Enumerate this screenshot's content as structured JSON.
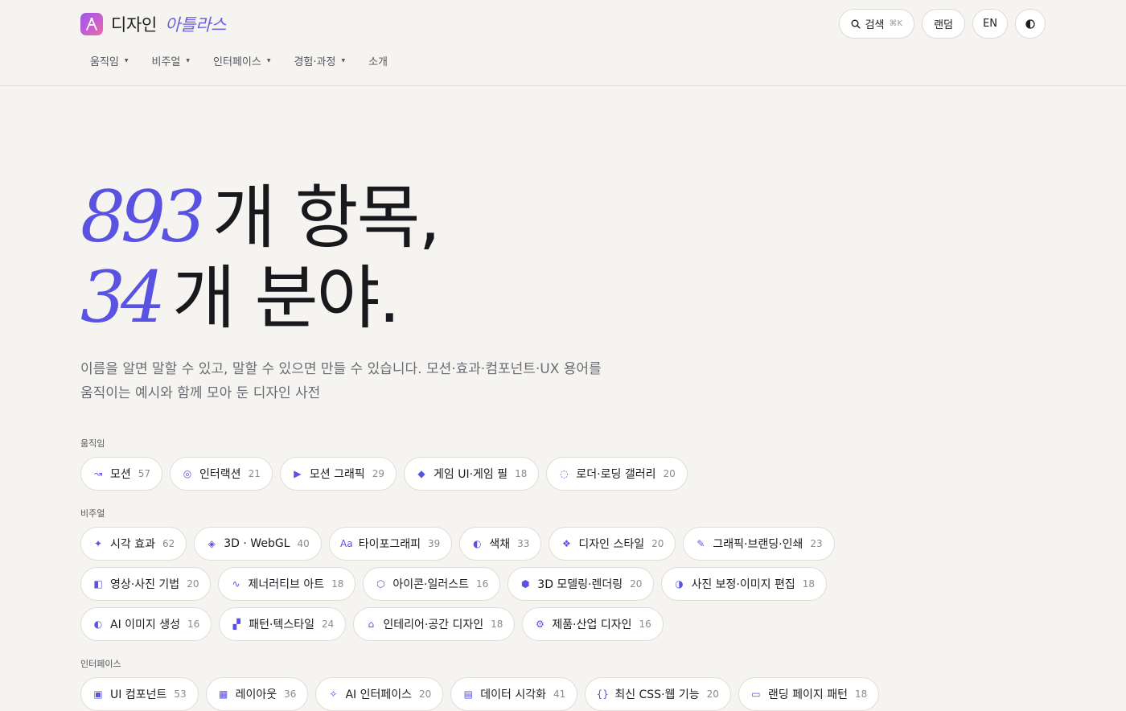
{
  "brand": {
    "name": "디자인",
    "accent": "아틀라스"
  },
  "top_actions": {
    "search_label": "검색",
    "search_shortcut": "⌘K",
    "random_label": "랜덤",
    "lang_label": "EN"
  },
  "nav": {
    "items": [
      {
        "label": "움직임",
        "has_menu": true
      },
      {
        "label": "비주얼",
        "has_menu": true
      },
      {
        "label": "인터페이스",
        "has_menu": true
      },
      {
        "label": "경험·과정",
        "has_menu": true
      },
      {
        "label": "소개",
        "has_menu": false
      }
    ]
  },
  "hero": {
    "line1_num": "893",
    "line1_text": "개 항목,",
    "line2_num": "34",
    "line2_text": "개 분야."
  },
  "subtitle": "이름을 알면 말할 수 있고, 말할 수 있으면 만들 수 있습니다. 모션·효과·컴포넌트·UX 용어를 움직이는 예시와 함께 모아 둔 디자인 사전",
  "colors": {
    "accent": "#5a52e0",
    "background": "#f6f4f0"
  },
  "sections": [
    {
      "label": "움직임",
      "rows": [
        [
          {
            "icon": "squiggle-arrow-icon",
            "glyph": "↝",
            "label": "모션",
            "count": "57"
          },
          {
            "icon": "target-circle-icon",
            "glyph": "◎",
            "label": "인터랙션",
            "count": "21"
          },
          {
            "icon": "play-triangle-icon",
            "glyph": "▶",
            "label": "모션 그래픽",
            "count": "29"
          },
          {
            "icon": "diamond-icon",
            "glyph": "◆",
            "label": "게임 UI·게임 필",
            "count": "18"
          },
          {
            "icon": "loader-ring-icon",
            "glyph": "◌",
            "label": "로더·로딩 갤러리",
            "count": "20"
          }
        ]
      ]
    },
    {
      "label": "비주얼",
      "rows": [
        [
          {
            "icon": "sparkle-icon",
            "glyph": "✦",
            "label": "시각 효과",
            "count": "62"
          },
          {
            "icon": "cube-diamond-icon",
            "glyph": "◈",
            "label": "3D · WebGL",
            "count": "40"
          },
          {
            "icon": "typography-icon",
            "glyph": "Aa",
            "label": "타이포그래피",
            "count": "39"
          },
          {
            "icon": "half-circle-icon",
            "glyph": "◐",
            "label": "색채",
            "count": "33"
          },
          {
            "icon": "four-diamonds-icon",
            "glyph": "❖",
            "label": "디자인 스타일",
            "count": "20"
          },
          {
            "icon": "pencil-icon",
            "glyph": "✎",
            "label": "그래픽·브랜딩·인쇄",
            "count": "23"
          }
        ],
        [
          {
            "icon": "half-square-icon",
            "glyph": "◧",
            "label": "영상·사진 기법",
            "count": "20"
          },
          {
            "icon": "wave-icon",
            "glyph": "∿",
            "label": "제너러티브 아트",
            "count": "18"
          },
          {
            "icon": "hexagon-outline-icon",
            "glyph": "⬡",
            "label": "아이콘·일러스트",
            "count": "16"
          },
          {
            "icon": "hexagon-filled-icon",
            "glyph": "⬢",
            "label": "3D 모델링·렌더링",
            "count": "20"
          },
          {
            "icon": "contrast-icon",
            "glyph": "◑",
            "label": "사진 보정·이미지 편집",
            "count": "18"
          }
        ],
        [
          {
            "icon": "half-circle-icon",
            "glyph": "◐",
            "label": "AI 이미지 생성",
            "count": "16"
          },
          {
            "icon": "pattern-blocks-icon",
            "glyph": "▞",
            "label": "패턴·텍스타일",
            "count": "24"
          },
          {
            "icon": "house-icon",
            "glyph": "⌂",
            "label": "인테리어·공간 디자인",
            "count": "18"
          },
          {
            "icon": "gear-icon",
            "glyph": "⚙",
            "label": "제품·산업 디자인",
            "count": "16"
          }
        ]
      ]
    },
    {
      "label": "인터페이스",
      "rows": [
        [
          {
            "icon": "component-square-icon",
            "glyph": "▣",
            "label": "UI 컴포넌트",
            "count": "53"
          },
          {
            "icon": "grid-icon",
            "glyph": "▦",
            "label": "레이아웃",
            "count": "36"
          },
          {
            "icon": "ai-sparkle-icon",
            "glyph": "✧",
            "label": "AI 인터페이스",
            "count": "20"
          },
          {
            "icon": "data-table-icon",
            "glyph": "▤",
            "label": "데이터 시각화",
            "count": "41"
          },
          {
            "icon": "braces-icon",
            "glyph": "{}",
            "label": "최신 CSS·웹 기능",
            "count": "20"
          },
          {
            "icon": "landing-rect-icon",
            "glyph": "▭",
            "label": "랜딩 페이지 패턴",
            "count": "18"
          }
        ]
      ]
    }
  ]
}
